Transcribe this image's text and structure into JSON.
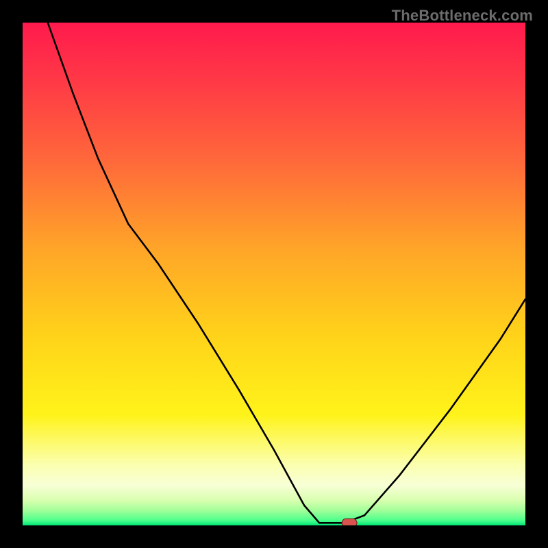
{
  "watermark": "TheBottleneck.com",
  "chart_data": {
    "type": "line",
    "title": "",
    "xlabel": "",
    "ylabel": "",
    "xlim": [
      0,
      100
    ],
    "ylim": [
      0,
      100
    ],
    "curve": [
      {
        "x": 5,
        "y": 100
      },
      {
        "x": 10,
        "y": 86
      },
      {
        "x": 15,
        "y": 73
      },
      {
        "x": 21,
        "y": 60
      },
      {
        "x": 27,
        "y": 52
      },
      {
        "x": 35,
        "y": 40
      },
      {
        "x": 43,
        "y": 27
      },
      {
        "x": 50,
        "y": 15
      },
      {
        "x": 56,
        "y": 4
      },
      {
        "x": 59,
        "y": 0.5
      },
      {
        "x": 64,
        "y": 0.5
      },
      {
        "x": 68,
        "y": 2
      },
      {
        "x": 75,
        "y": 10
      },
      {
        "x": 85,
        "y": 23
      },
      {
        "x": 95,
        "y": 37
      },
      {
        "x": 100,
        "y": 45
      }
    ],
    "marker": {
      "x": 65,
      "y": 0.5
    },
    "gradient_meaning": "green = no bottleneck (low y), red = severe bottleneck (high y)"
  }
}
